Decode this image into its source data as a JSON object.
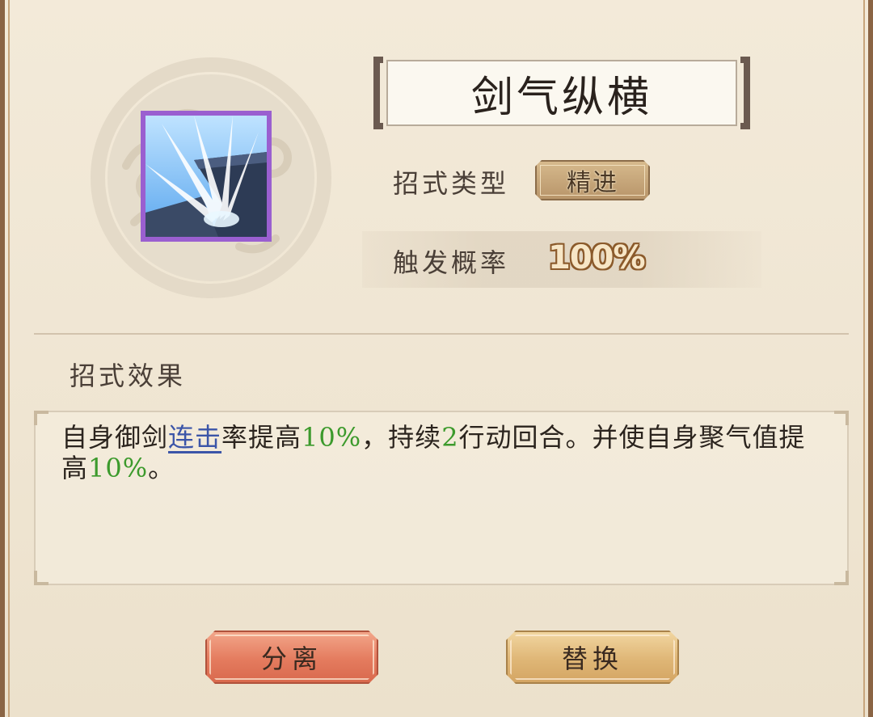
{
  "skill": {
    "name": "剑气纵横",
    "type_label": "招式类型",
    "type_value": "精进",
    "rate_label": "触发概率",
    "rate_value": "100%",
    "icon": "sword-qi-burst-icon",
    "icon_frame_color": "#9a5fd0"
  },
  "effect": {
    "heading": "招式效果",
    "segments": [
      {
        "text": "自身御剑",
        "style": "normal"
      },
      {
        "text": "连击",
        "style": "link"
      },
      {
        "text": "率提高",
        "style": "normal"
      },
      {
        "text": "10%",
        "style": "green"
      },
      {
        "text": "，持续",
        "style": "normal"
      },
      {
        "text": "2",
        "style": "green"
      },
      {
        "text": "行动回合。并使自身聚气值提高",
        "style": "normal"
      },
      {
        "text": "10%",
        "style": "green"
      },
      {
        "text": "。",
        "style": "normal"
      }
    ]
  },
  "buttons": {
    "separate_label": "分离",
    "replace_label": "替换"
  },
  "colors": {
    "highlight_green": "#3c9a2c",
    "link_blue": "#3b55a8",
    "separate_button": "#e47b5e",
    "replace_button": "#dfb676"
  }
}
